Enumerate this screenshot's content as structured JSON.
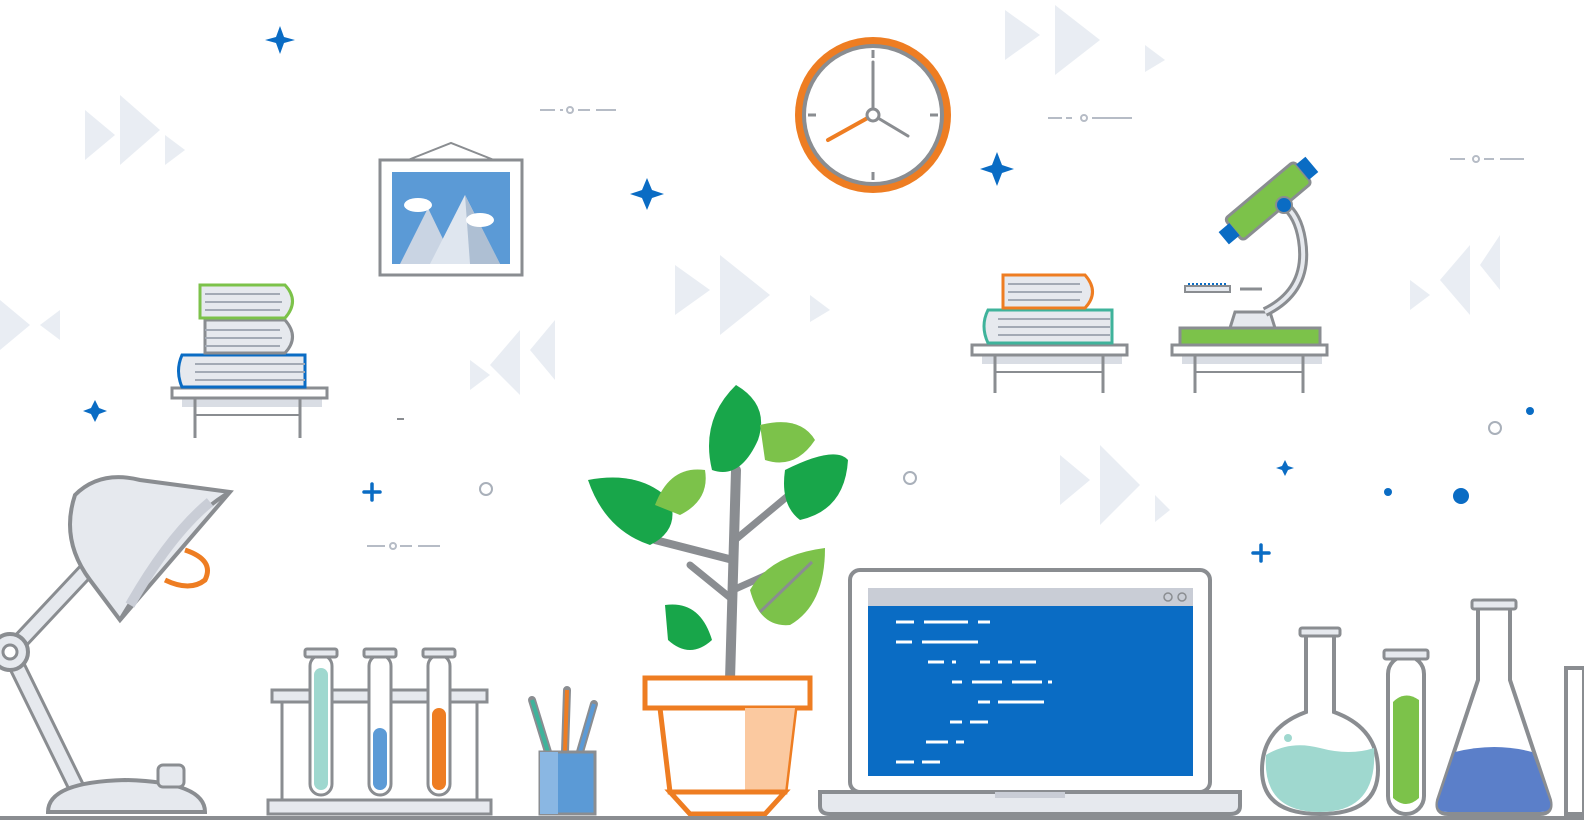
{
  "scene": {
    "description_items": [
      "clock",
      "framed-picture",
      "book-stack",
      "microscope",
      "desk-lamp",
      "test-tubes",
      "pencil-cup",
      "potted-plant",
      "laptop",
      "lab-flasks"
    ],
    "colors": {
      "background": "#ffffff",
      "outline": "#8a8d91",
      "blue": "#0a6cc4",
      "light_blue": "#5b9ad6",
      "orange": "#ee7d22",
      "green": "#18a64a",
      "light_green": "#7cc24a",
      "teal": "#9fd8cf",
      "grey_fill": "#c9cdd6",
      "faint": "#e9edf3",
      "screen": "#0a6cc4"
    },
    "clock_time": "8:00"
  }
}
